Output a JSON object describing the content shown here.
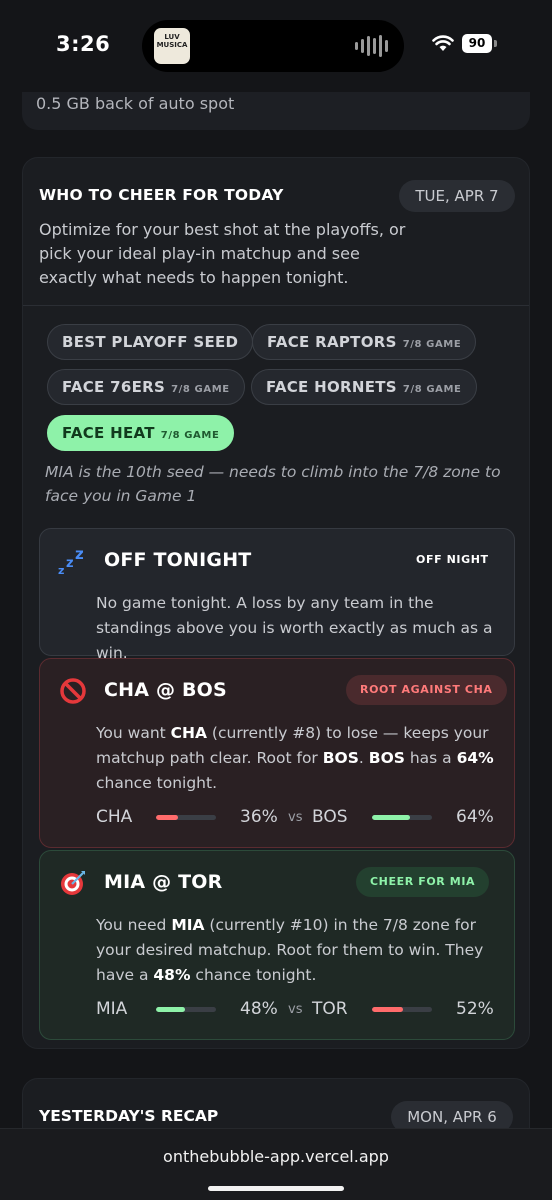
{
  "status_bar": {
    "time": "3:26",
    "battery": "90",
    "album_art_text": "LUV MUSICA"
  },
  "prev_card": {
    "text": "0.5 GB back of auto spot"
  },
  "cheer_card": {
    "title": "WHO TO CHEER FOR TODAY",
    "date": "TUE, APR 7",
    "description": "Optimize for your best shot at the playoffs, or pick your ideal play-in matchup and see exactly what needs to happen tonight.",
    "chips": [
      {
        "label": "BEST PLAYOFF SEED",
        "sub": "",
        "active": false
      },
      {
        "label": "FACE RAPTORS",
        "sub": "7/8 GAME",
        "active": false
      },
      {
        "label": "FACE 76ERS",
        "sub": "7/8 GAME",
        "active": false
      },
      {
        "label": "FACE HORNETS",
        "sub": "7/8 GAME",
        "active": false
      },
      {
        "label": "FACE HEAT",
        "sub": "7/8 GAME",
        "active": true
      }
    ],
    "note": "MIA is the 10th seed — needs to climb into the 7/8 zone to face you in Game 1",
    "games": {
      "off": {
        "icon": "sleeping-zzz-icon",
        "title": "OFF TONIGHT",
        "badge": "OFF NIGHT",
        "body": "No game tonight. A loss by any team in the standings above you is worth exactly as much as a win."
      },
      "against": {
        "icon": "prohibited-icon",
        "title": "CHA @ BOS",
        "badge": "ROOT AGAINST CHA",
        "body_parts": [
          "You want ",
          "CHA",
          " (currently #8) to lose — keeps your matchup path clear. Root for ",
          "BOS",
          ". ",
          "BOS",
          " has a ",
          "64%",
          " chance tonight."
        ],
        "team1": "CHA",
        "team1_pct": "36%",
        "team1_value": 36,
        "vs": "vs",
        "team2": "BOS",
        "team2_pct": "64%",
        "team2_value": 64
      },
      "cheer": {
        "icon": "target-dart-icon",
        "title": "MIA @ TOR",
        "badge": "CHEER FOR MIA",
        "body_parts": [
          "You need ",
          "MIA",
          " (currently #10) in the 7/8 zone for your desired matchup. Root for them to win. They have a ",
          "48%",
          " chance tonight."
        ],
        "team1": "MIA",
        "team1_pct": "48%",
        "team1_value": 48,
        "vs": "vs",
        "team2": "TOR",
        "team2_pct": "52%",
        "team2_value": 52
      }
    }
  },
  "recap_card": {
    "title": "YESTERDAY'S RECAP",
    "date": "MON, APR 6"
  },
  "browser": {
    "url": "onthebubble-app.vercel.app"
  },
  "colors": {
    "accent_green": "#8ef2a9",
    "accent_red": "#ff7a7a",
    "background": "#141518"
  }
}
